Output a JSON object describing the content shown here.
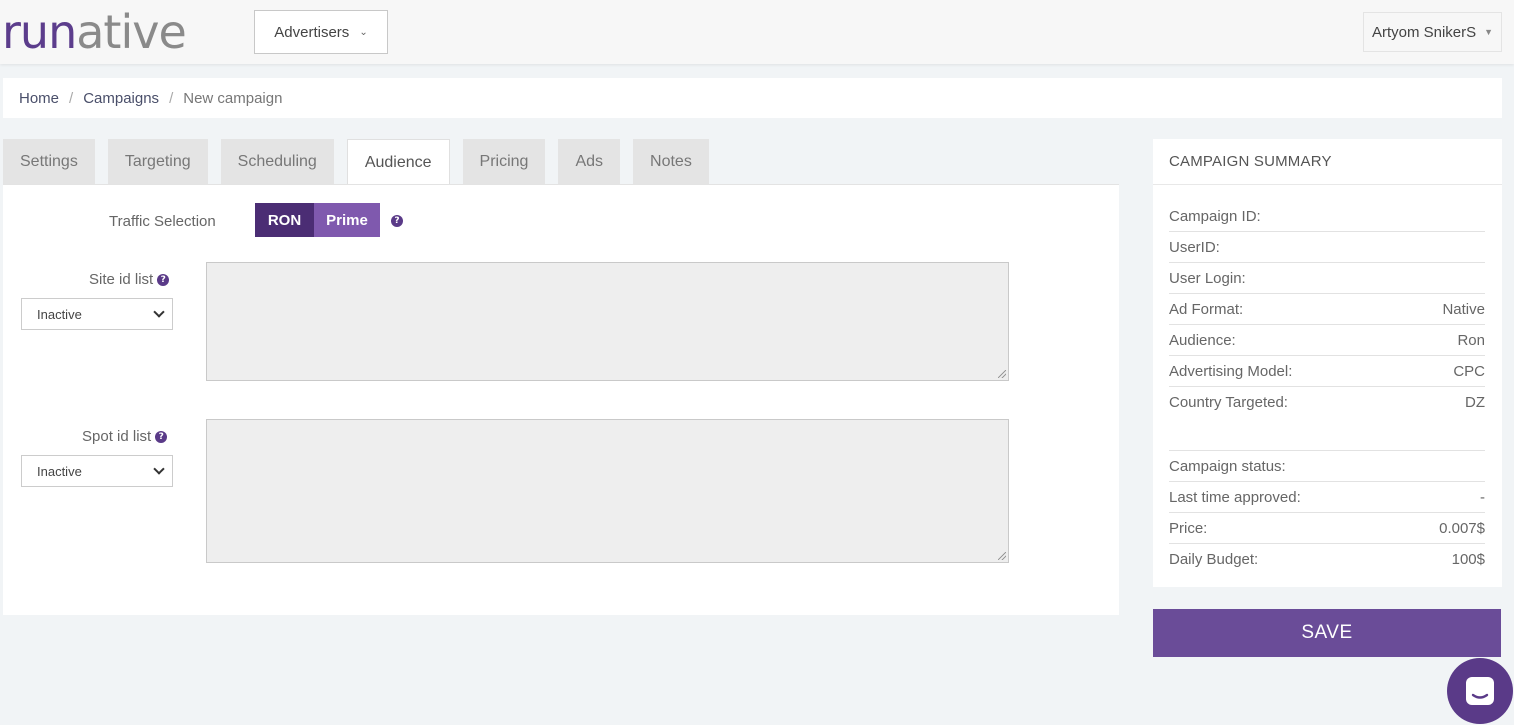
{
  "header": {
    "logo": {
      "part1": "run",
      "part2": "ative"
    },
    "advertisers_label": "Advertisers",
    "user_name": "Artyom SnikerS"
  },
  "breadcrumb": {
    "home": "Home",
    "campaigns": "Campaigns",
    "current": "New campaign"
  },
  "tabs": [
    {
      "label": "Settings"
    },
    {
      "label": "Targeting"
    },
    {
      "label": "Scheduling"
    },
    {
      "label": "Audience"
    },
    {
      "label": "Pricing"
    },
    {
      "label": "Ads"
    },
    {
      "label": "Notes"
    }
  ],
  "active_tab": "Audience",
  "audience": {
    "traffic_selection_label": "Traffic Selection",
    "toggle_ron": "RON",
    "toggle_prime": "Prime",
    "site_id_label": "Site id list",
    "site_id_select": "Inactive",
    "spot_id_label": "Spot id list",
    "spot_id_select": "Inactive",
    "help_glyph": "?"
  },
  "summary": {
    "title": "CAMPAIGN SUMMARY",
    "rows1": [
      {
        "label": "Campaign ID:",
        "value": ""
      },
      {
        "label": "UserID:",
        "value": ""
      },
      {
        "label": "User Login:",
        "value": ""
      },
      {
        "label": "Ad Format:",
        "value": "Native"
      },
      {
        "label": "Audience:",
        "value": "Ron"
      },
      {
        "label": "Advertising Model:",
        "value": "CPC"
      },
      {
        "label": "Country Targeted:",
        "value": "DZ"
      }
    ],
    "rows2": [
      {
        "label": "Campaign status:",
        "value": ""
      },
      {
        "label": "Last time approved:",
        "value": "-"
      },
      {
        "label": "Price:",
        "value": "0.007$"
      },
      {
        "label": "Daily Budget:",
        "value": "100$"
      }
    ]
  },
  "save_label": "SAVE",
  "colors": {
    "brand": "#5c3d8c",
    "save": "#6a4c98",
    "toggle_dark": "#4b2d74",
    "toggle_light": "#7f59ae"
  }
}
